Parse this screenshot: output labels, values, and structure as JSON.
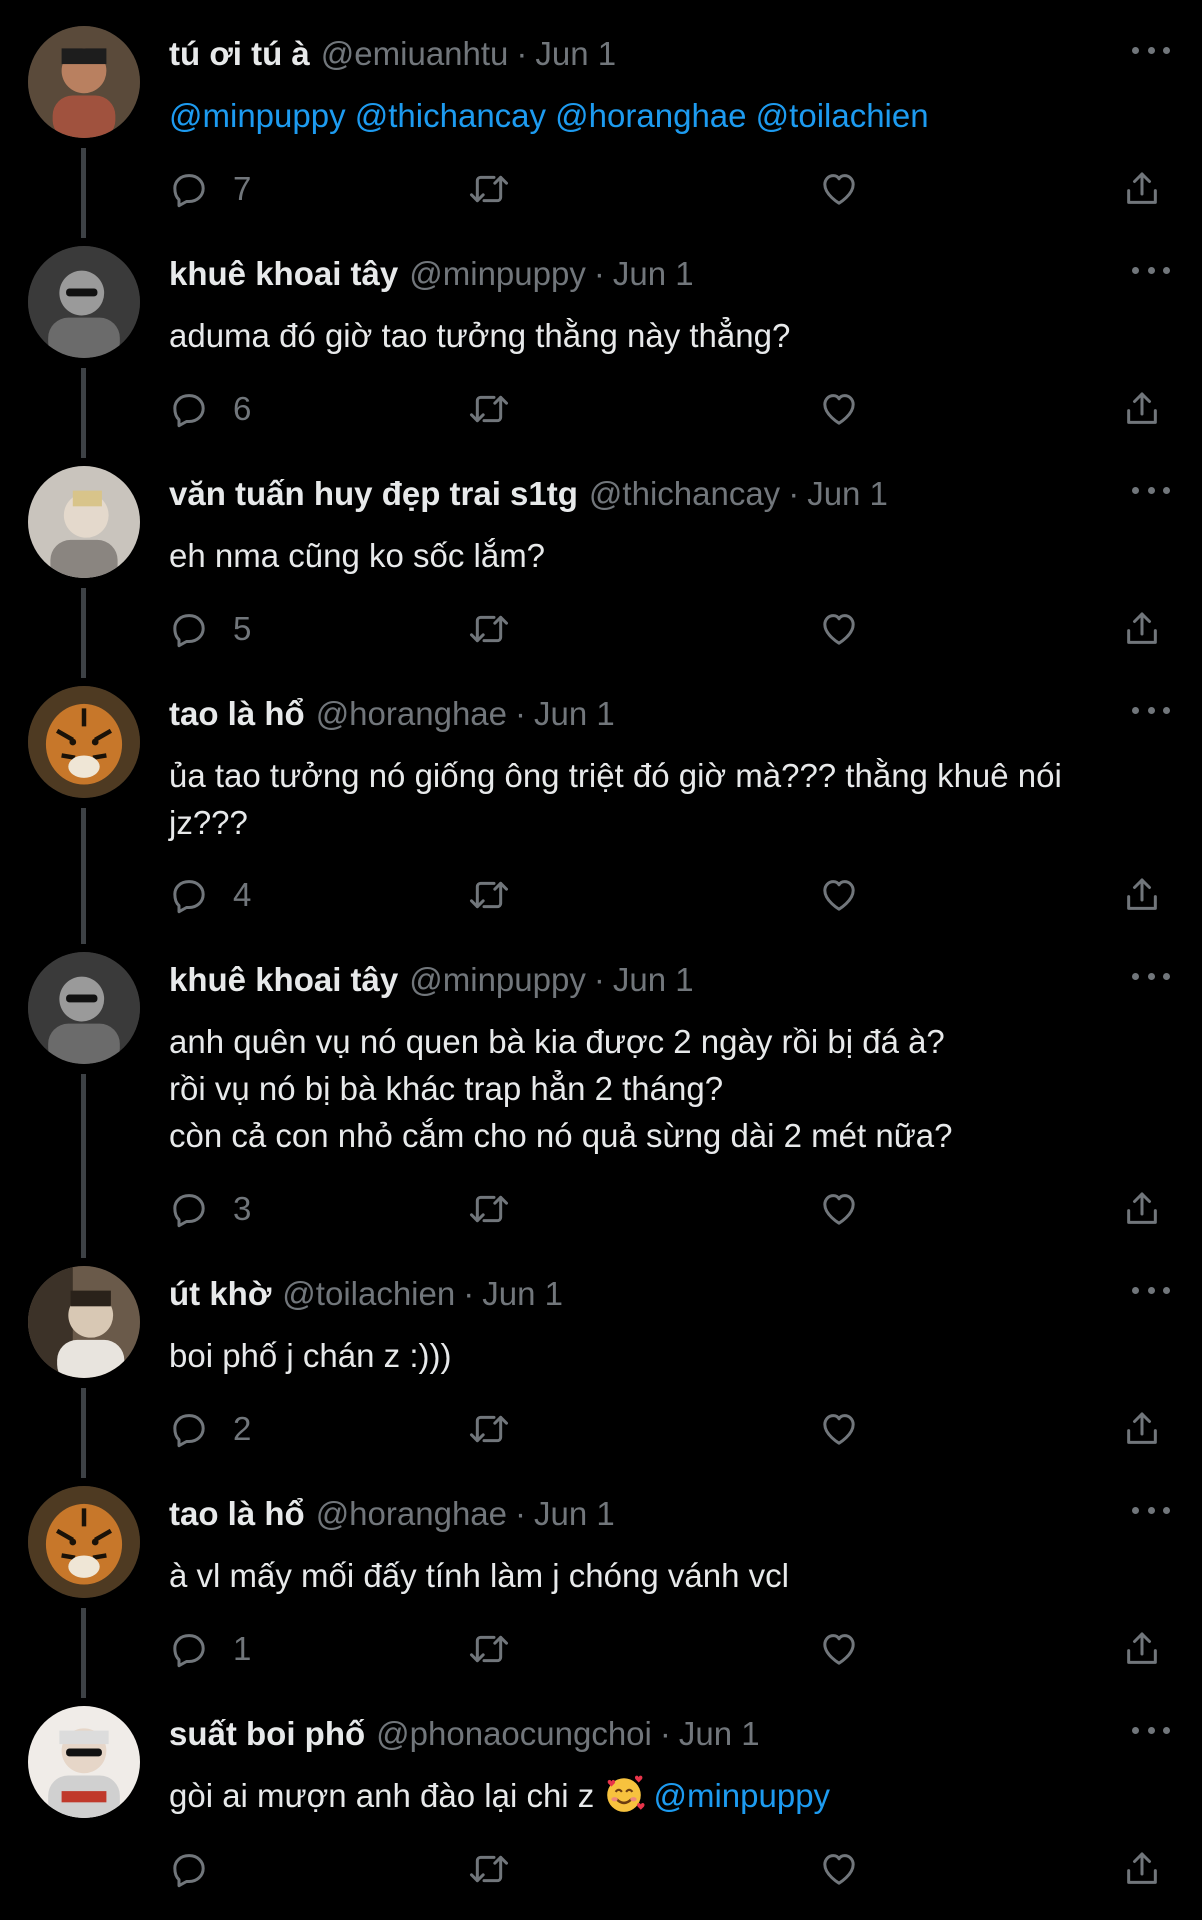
{
  "tweets": [
    {
      "name": "tú ơi tú à",
      "handle": "@emiuanhtu",
      "separator": "·",
      "date": "Jun 1",
      "text_before": "",
      "mentions": "@minpuppy @thichancay @horanghae @toilachien",
      "reply_count": "7",
      "avatar_icon": "user-photo-avatar",
      "avatar_colors": [
        "#5a4a3a",
        "#b98060"
      ]
    },
    {
      "name": "khuê khoai tây",
      "handle": "@minpuppy",
      "separator": "·",
      "date": "Jun 1",
      "lines": [
        "aduma đó giờ tao tưởng thằng này thẳng?"
      ],
      "reply_count": "6",
      "avatar_icon": "user-photo-avatar",
      "avatar_colors": [
        "#3a3a3a",
        "#9a9a9a"
      ]
    },
    {
      "name": "văn tuấn huy đẹp trai s1tg",
      "handle": "@thichancay",
      "separator": "·",
      "date": "Jun 1",
      "lines": [
        "eh nma cũng ko sốc lắm?"
      ],
      "reply_count": "5",
      "avatar_icon": "user-photo-avatar",
      "avatar_colors": [
        "#c9c4bd",
        "#e4d9cc"
      ]
    },
    {
      "name": "tao là hổ",
      "handle": "@horanghae",
      "separator": "·",
      "date": "Jun 1",
      "lines": [
        "ủa tao tưởng nó giống ông triệt đó giờ mà??? thằng khuê nói",
        "jz???"
      ],
      "reply_count": "4",
      "avatar_icon": "tiger-avatar",
      "avatar_colors": [
        "#4e3a22",
        "#c7772a"
      ]
    },
    {
      "name": "khuê khoai tây",
      "handle": "@minpuppy",
      "separator": "·",
      "date": "Jun 1",
      "lines": [
        "anh quên vụ nó quen bà kia được 2 ngày rồi bị đá à?",
        "rồi vụ nó bị bà khác trap hẳn 2 tháng?",
        "còn cả con nhỏ cắm cho nó quả sừng dài 2 mét nữa?"
      ],
      "reply_count": "3",
      "avatar_icon": "user-photo-avatar",
      "avatar_colors": [
        "#3a3a3a",
        "#9a9a9a"
      ]
    },
    {
      "name": "út khờ",
      "handle": "@toilachien",
      "separator": "·",
      "date": "Jun 1",
      "lines": [
        "boi phố j chán z :)))"
      ],
      "reply_count": "2",
      "avatar_icon": "user-photo-avatar",
      "avatar_colors": [
        "#6a5a4a",
        "#d8c8b4"
      ]
    },
    {
      "name": "tao là hổ",
      "handle": "@horanghae",
      "separator": "·",
      "date": "Jun 1",
      "lines": [
        "à vl mấy mối đấy tính làm j chóng vánh vcl"
      ],
      "reply_count": "1",
      "avatar_icon": "tiger-avatar",
      "avatar_colors": [
        "#4e3a22",
        "#c7772a"
      ]
    },
    {
      "name": "suất boi phố",
      "handle": "@phonaocungchoi",
      "separator": "·",
      "date": "Jun 1",
      "text_before": "gòi ai mượn anh đào lại chi z ",
      "emoji_icon": "smiling-face-with-hearts-icon",
      "mentions": "@minpuppy",
      "reply_count": "",
      "avatar_icon": "user-photo-avatar",
      "avatar_colors": [
        "#d9d9d9",
        "#f0ece8"
      ]
    }
  ],
  "icons": {
    "reply": "reply-icon",
    "retweet": "retweet-icon",
    "like": "heart-icon",
    "share": "share-icon",
    "more": "more-options-icon"
  },
  "colors": {
    "background": "#000000",
    "text": "#e7e9ea",
    "muted": "#71767b",
    "link": "#1d9bf0",
    "thread_line": "#3d4145"
  }
}
